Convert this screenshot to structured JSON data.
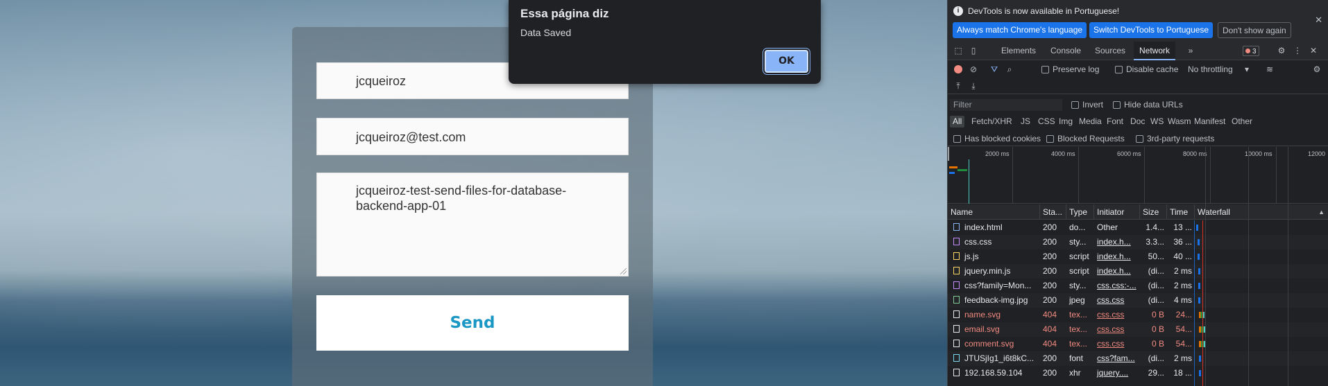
{
  "form": {
    "name_value": "jcqueiroz",
    "email_value": "jcqueiroz@test.com",
    "comment_value": "jcqueiroz-test-send-files-for-database-backend-app-01",
    "send_label": "Send"
  },
  "dialog": {
    "title": "Essa página diz",
    "message": "Data Saved",
    "ok_label": "OK"
  },
  "devtools": {
    "info_text": "DevTools is now available in Portuguese!",
    "btn_match": "Always match Chrome's language",
    "btn_switch": "Switch DevTools to Portuguese",
    "btn_dont_show": "Don't show again",
    "tabs": [
      "Elements",
      "Console",
      "Sources",
      "Network"
    ],
    "active_tab": "Network",
    "error_count": "3",
    "toolbar": {
      "preserve_log": "Preserve log",
      "disable_cache": "Disable cache",
      "throttling": "No throttling"
    },
    "filter_placeholder": "Filter",
    "invert": "Invert",
    "hide_data_urls": "Hide data URLs",
    "types": [
      "All",
      "Fetch/XHR",
      "JS",
      "CSS",
      "Img",
      "Media",
      "Font",
      "Doc",
      "WS",
      "Wasm",
      "Manifest",
      "Other"
    ],
    "checks": [
      "Has blocked cookies",
      "Blocked Requests",
      "3rd-party requests"
    ],
    "timeline_ticks": [
      "2000 ms",
      "4000 ms",
      "6000 ms",
      "8000 ms",
      "10000 ms",
      "12000"
    ],
    "columns": [
      "Name",
      "Sta...",
      "Type",
      "Initiator",
      "Size",
      "Time",
      "Waterfall"
    ],
    "rows": [
      {
        "name": "index.html",
        "status": "200",
        "type": "do...",
        "initiator": "Other",
        "size": "1.4...",
        "time": "13 ...",
        "icon": "document-icon",
        "error": false
      },
      {
        "name": "css.css",
        "status": "200",
        "type": "sty...",
        "initiator": "index.h...",
        "size": "3.3...",
        "time": "36 ...",
        "icon": "stylesheet-icon",
        "error": false
      },
      {
        "name": "js.js",
        "status": "200",
        "type": "script",
        "initiator": "index.h...",
        "size": "50...",
        "time": "40 ...",
        "icon": "script-icon",
        "error": false
      },
      {
        "name": "jquery.min.js",
        "status": "200",
        "type": "script",
        "initiator": "index.h...",
        "size": "(di...",
        "time": "2 ms",
        "icon": "script-icon",
        "error": false
      },
      {
        "name": "css?family=Mon...",
        "status": "200",
        "type": "sty...",
        "initiator": "css.css:-...",
        "size": "(di...",
        "time": "2 ms",
        "icon": "stylesheet-icon",
        "error": false
      },
      {
        "name": "feedback-img.jpg",
        "status": "200",
        "type": "jpeg",
        "initiator": "css.css",
        "size": "(di...",
        "time": "4 ms",
        "icon": "image-icon",
        "error": false
      },
      {
        "name": "name.svg",
        "status": "404",
        "type": "tex...",
        "initiator": "css.css",
        "size": "0 B",
        "time": "24...",
        "icon": "file-icon",
        "error": true
      },
      {
        "name": "email.svg",
        "status": "404",
        "type": "tex...",
        "initiator": "css.css",
        "size": "0 B",
        "time": "54...",
        "icon": "file-icon",
        "error": true
      },
      {
        "name": "comment.svg",
        "status": "404",
        "type": "tex...",
        "initiator": "css.css",
        "size": "0 B",
        "time": "54...",
        "icon": "file-icon",
        "error": true
      },
      {
        "name": "JTUSjIg1_i6t8kC...",
        "status": "200",
        "type": "font",
        "initiator": "css?fam...",
        "size": "(di...",
        "time": "2 ms",
        "icon": "font-icon",
        "error": false
      },
      {
        "name": "192.168.59.104",
        "status": "200",
        "type": "xhr",
        "initiator": "jquery....",
        "size": "29...",
        "time": "18 ...",
        "icon": "file-icon",
        "error": false
      }
    ],
    "colors": {
      "accent": "#8ab4f8",
      "error": "#f28b82",
      "button": "#1a73e8"
    }
  }
}
